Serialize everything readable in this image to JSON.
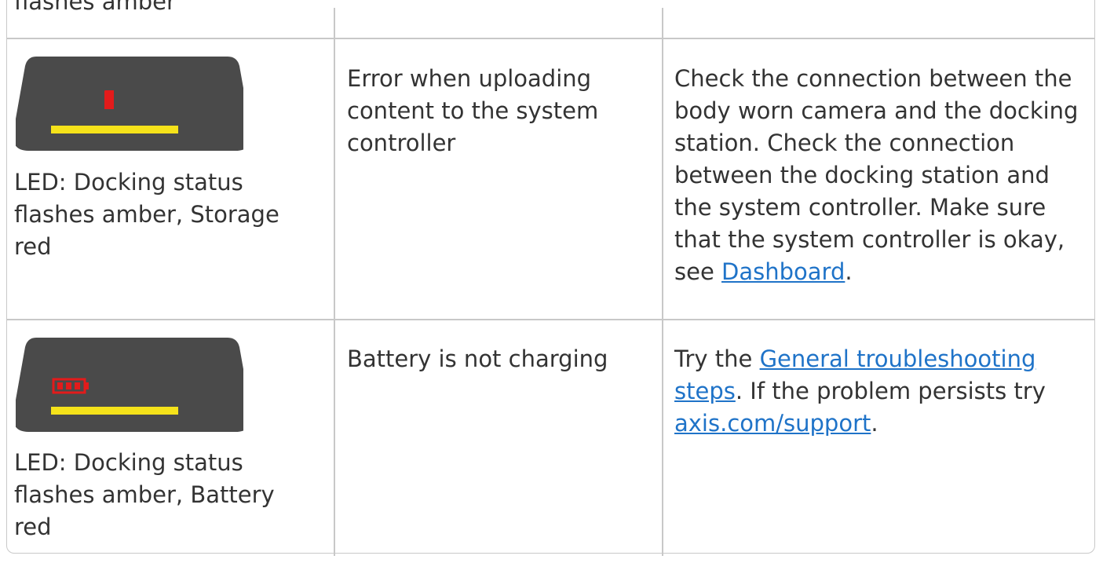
{
  "rows": [
    {
      "led_caption_cut": "flashes amber"
    },
    {
      "icon": "storage-card-icon",
      "icon_color": "#e31b1b",
      "bar_color": "#f5e21a",
      "device_color": "#4a4a4a",
      "led": "LED: Docking status flashes amber, Storage red",
      "led_lines": [
        "LED: Docking status",
        "flashes amber, Storage",
        "red"
      ],
      "problem_lines": [
        "Error when uploading",
        "content to the system",
        "controller"
      ],
      "solution_lines": [
        "Check the connection between the",
        "body worn camera and the docking",
        "station. Check the connection",
        "between the docking station and",
        "the system controller. Make sure",
        "that the system controller is okay,"
      ],
      "solution_tail_prefix": "see ",
      "solution_link": "Dashboard",
      "solution_tail_suffix": "."
    },
    {
      "icon": "battery-icon",
      "icon_color": "#e31b1b",
      "bar_color": "#f5e21a",
      "device_color": "#4a4a4a",
      "led_lines": [
        "LED: Docking status",
        "flashes amber, Battery",
        "red"
      ],
      "problem": "Battery is not charging",
      "solution_prefix": "Try the ",
      "solution_link1_part1": "General troubleshooting",
      "solution_link1_part2": "steps",
      "solution_mid": ". If the problem persists try",
      "solution_link2": "axis.com/support",
      "solution_suffix": "."
    }
  ]
}
